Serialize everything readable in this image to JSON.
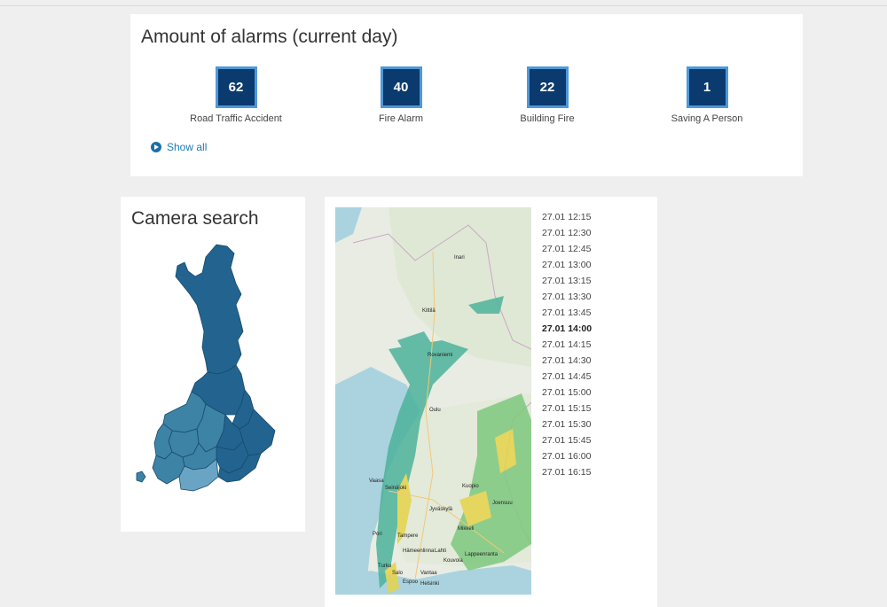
{
  "alarms": {
    "title": "Amount of alarms (current day)",
    "items": [
      {
        "count": "62",
        "label": "Road Traffic Accident"
      },
      {
        "count": "40",
        "label": "Fire Alarm"
      },
      {
        "count": "22",
        "label": "Building Fire"
      },
      {
        "count": "1",
        "label": "Saving A Person"
      }
    ],
    "show_all": "Show all"
  },
  "camera": {
    "title": "Camera search",
    "region_color": "#22648f",
    "south_color": "#3d83a6"
  },
  "radar": {
    "cities": [
      "Inari",
      "Kittilä",
      "Rovaniemi",
      "Oulu",
      "Vaasa",
      "Seinäjoki",
      "Kuopio",
      "Joensuu",
      "Jyväskylä",
      "Mikkeli",
      "Pori",
      "Tampere",
      "Hämeenlinna",
      "Lahti",
      "Lappeenranta",
      "Turku",
      "Kouvola",
      "Salo",
      "Espoo",
      "Vantaa",
      "Helsinki"
    ],
    "times": [
      "27.01 12:15",
      "27.01 12:30",
      "27.01 12:45",
      "27.01 13:00",
      "27.01 13:15",
      "27.01 13:30",
      "27.01 13:45",
      "27.01 14:00",
      "27.01 14:15",
      "27.01 14:30",
      "27.01 14:45",
      "27.01 15:00",
      "27.01 15:15",
      "27.01 15:30",
      "27.01 15:45",
      "27.01 16:00",
      "27.01 16:15"
    ],
    "selected_time": "27.01 14:00"
  }
}
